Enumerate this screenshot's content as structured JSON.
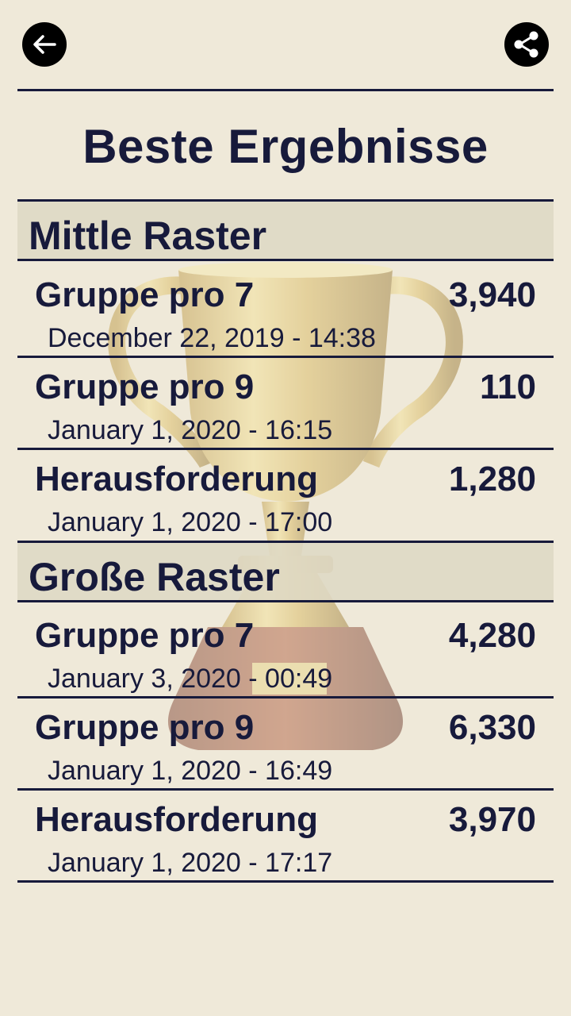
{
  "title": "Beste Ergebnisse",
  "toolbar": {
    "back_icon": "arrow-left-icon",
    "share_icon": "share-icon"
  },
  "sections": [
    {
      "header": "Mittle Raster",
      "rows": [
        {
          "name": "Gruppe pro 7",
          "score": "3,940",
          "date": "December 22, 2019 - 14:38"
        },
        {
          "name": "Gruppe pro 9",
          "score": "110",
          "date": "January 1, 2020 - 16:15"
        },
        {
          "name": "Herausforderung",
          "score": "1,280",
          "date": "January 1, 2020 - 17:00"
        }
      ]
    },
    {
      "header": "Große Raster",
      "rows": [
        {
          "name": "Gruppe pro 7",
          "score": "4,280",
          "date": "January 3, 2020 - 00:49"
        },
        {
          "name": "Gruppe pro 9",
          "score": "6,330",
          "date": "January 1, 2020 - 16:49"
        },
        {
          "name": "Herausforderung",
          "score": "3,970",
          "date": "January 1, 2020 - 17:17"
        }
      ]
    }
  ],
  "colors": {
    "background": "#efe9d9",
    "text": "#171a3b",
    "section_header": "#ded8c4"
  }
}
